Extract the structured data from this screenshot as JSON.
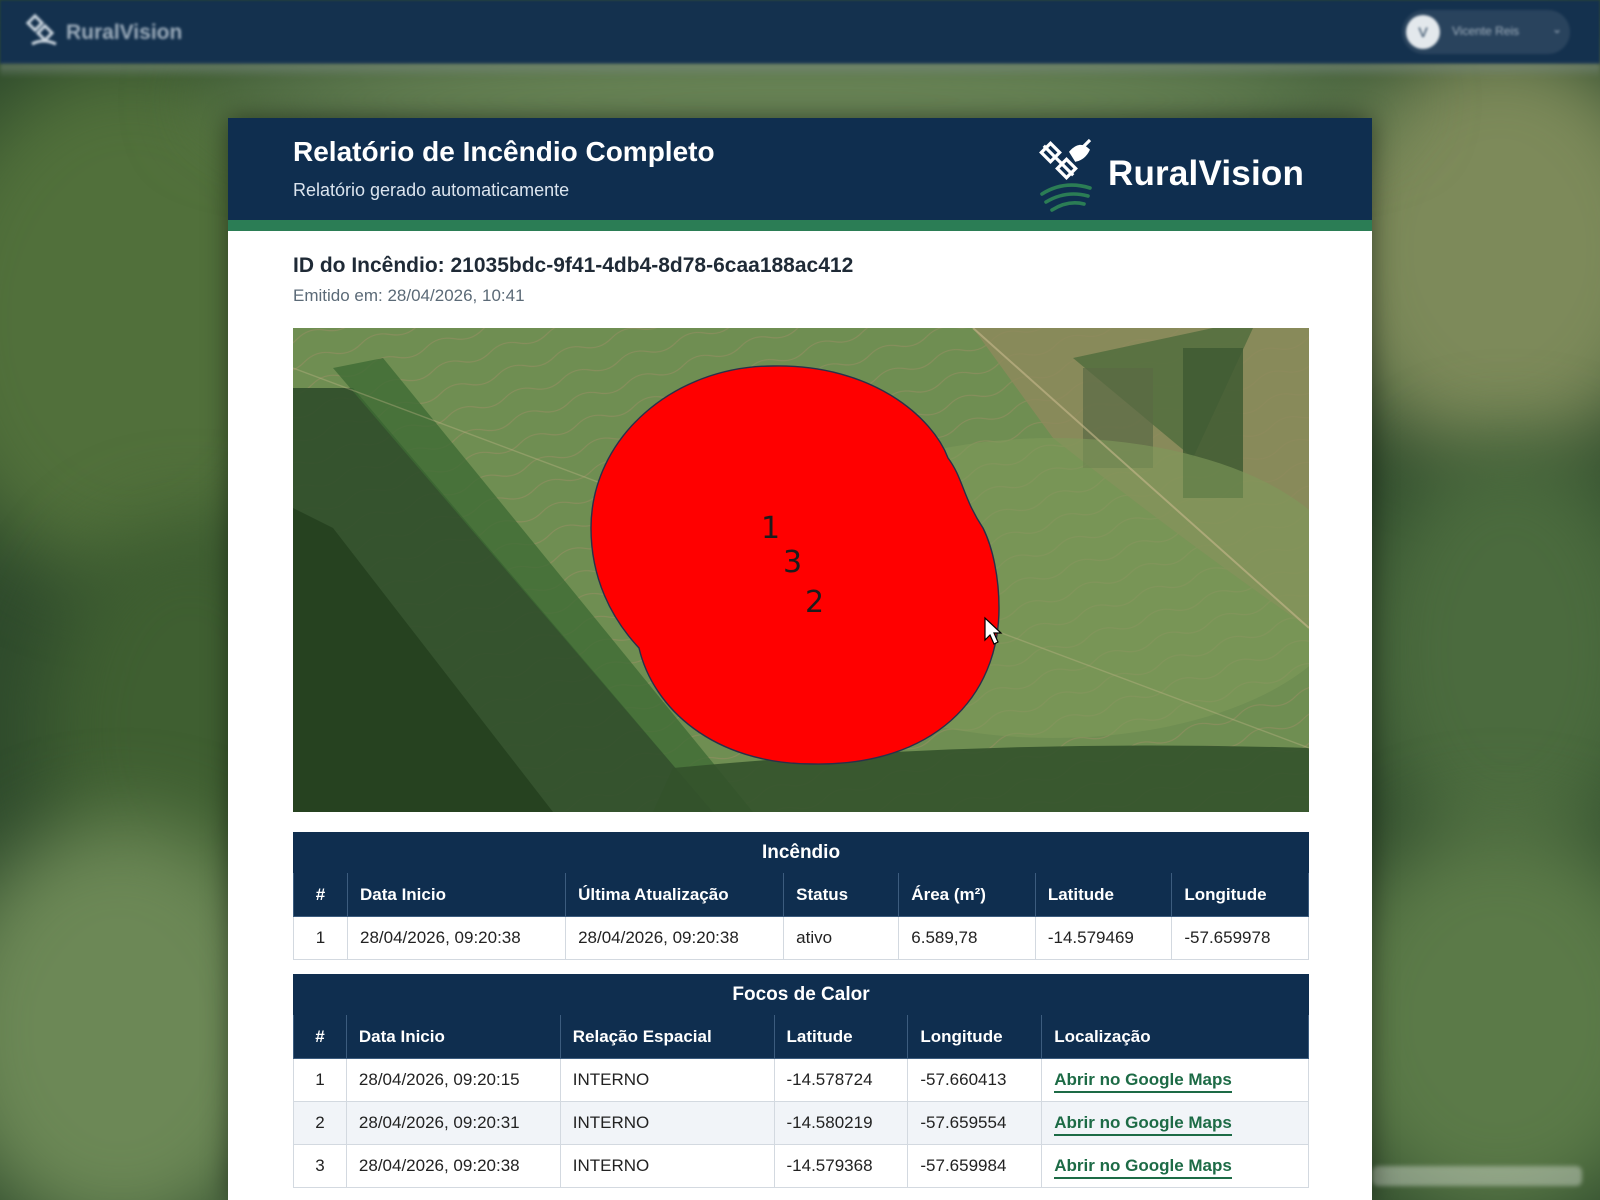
{
  "app": {
    "brand": "RuralVision",
    "user_initials": "V",
    "user_name": "Vicente Reis"
  },
  "report": {
    "title": "Relatório de Incêndio Completo",
    "subtitle": "Relatório gerado automaticamente",
    "logo_text": "RuralVision",
    "fire_id": "ID do Incêndio: 21035bdc-9f41-4db4-8d78-6caa188ac412",
    "issued": "Emitido em: 28/04/2026, 10:41"
  },
  "map": {
    "labels": [
      "1",
      "3",
      "2"
    ],
    "fire_color": "#ff0000"
  },
  "fire_table": {
    "caption": "Incêndio",
    "columns": [
      "#",
      "Data Inicio",
      "Última Atualização",
      "Status",
      "Área (m²)",
      "Latitude",
      "Longitude"
    ],
    "rows": [
      [
        "1",
        "28/04/2026, 09:20:38",
        "28/04/2026, 09:20:38",
        "ativo",
        "6.589,78",
        "-14.579469",
        "-57.659978"
      ]
    ]
  },
  "hotspots_table": {
    "caption": "Focos de Calor",
    "columns": [
      "#",
      "Data Inicio",
      "Relação Espacial",
      "Latitude",
      "Longitude",
      "Localização"
    ],
    "rows": [
      [
        "1",
        "28/04/2026, 09:20:15",
        "INTERNO",
        "-14.578724",
        "-57.660413",
        "Abrir no Google Maps"
      ],
      [
        "2",
        "28/04/2026, 09:20:31",
        "INTERNO",
        "-14.580219",
        "-57.659554",
        "Abrir no Google Maps"
      ],
      [
        "3",
        "28/04/2026, 09:20:38",
        "INTERNO",
        "-14.579368",
        "-57.659984",
        "Abrir no Google Maps"
      ]
    ]
  },
  "colors": {
    "header": "#0f2e4f",
    "accent": "#2b7d55",
    "link": "#1d6b46"
  }
}
